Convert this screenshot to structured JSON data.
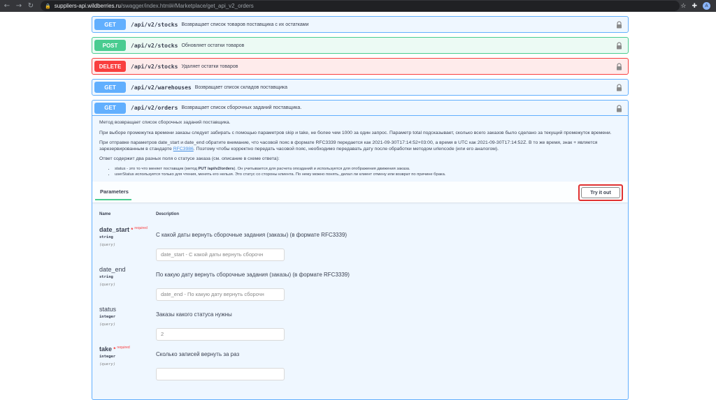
{
  "browser": {
    "url_host": "suppliers-api.wildberries.ru",
    "url_path": "/swagger/index.html#/Marketplace/get_api_v2_orders",
    "avatar_letter": "A"
  },
  "endpoints": [
    {
      "method": "GET",
      "path": "/api/v2/stocks",
      "summary": "Возвращает список товаров поставщика с их остатками",
      "kind": "get"
    },
    {
      "method": "POST",
      "path": "/api/v2/stocks",
      "summary": "Обновляет остатки товаров",
      "kind": "post"
    },
    {
      "method": "DELETE",
      "path": "/api/v2/stocks",
      "summary": "Удаляет остатки товаров",
      "kind": "delete"
    },
    {
      "method": "GET",
      "path": "/api/v2/warehouses",
      "summary": "Возвращает список складов поставщика",
      "kind": "get"
    }
  ],
  "expanded": {
    "method": "GET",
    "path": "/api/v2/orders",
    "summary": "Возвращает список сборочных заданий поставщика.",
    "desc1": "Метод возвращает список сборочных заданий поставщика.",
    "desc2": "При выборе промежутка времени заказы следует забирать с помощью параметров skip и take, не более чем 1000 за один запрос. Параметр total подсказывает, сколько всего заказов было сделано за текущий промежуток времени.",
    "desc3a": "При отправке параметров date_start и date_end обратите внимание, что часовой пояс в формате RFC3339 передается как 2021-09-30T17:14:52+03:00, а время в UTC как 2021-09-30T17:14:52Z. В то же время, знак + является зарезервированным в стандарте ",
    "desc3link": "RFC3986",
    "desc3b": ". Поэтому чтобы корректно передать часовой пояс, необходимо передавать дату после обработки методом urlencode (или его аналогом).",
    "desc4": "Ответ содержит два разных поля о статусе заказа (см. описание в схеме ответа):",
    "bullet1a": "status - это то что меняет поставщик (метод ",
    "bullet1b": "PUT /api/v2/orders",
    "bullet1c": "). Он учитывается для расчета опозданий и используется для отображения движения заказа.",
    "bullet2": "userStatus используется только для чтения, менять его нельзя. Это статус со стороны клиента. По нему можно понять, делал ли клиент отмену или возврат по причине брака."
  },
  "params": {
    "tab_label": "Parameters",
    "try_label": "Try it out",
    "col_name": "Name",
    "col_desc": "Description",
    "required_label": "required",
    "items": [
      {
        "name": "date_start",
        "required": true,
        "type": "string",
        "in": "(query)",
        "desc": "С какой даты вернуть сборочные задания (заказы) (в формате RFC3339)",
        "placeholder": "date_start - С какой даты вернуть сборочн"
      },
      {
        "name": "date_end",
        "required": false,
        "type": "string",
        "in": "(query)",
        "desc": "По какую дату вернуть сборочные задания (заказы) (в формате RFC3339)",
        "placeholder": "date_end - По какую дату вернуть сборочн"
      },
      {
        "name": "status",
        "required": false,
        "type": "integer",
        "in": "(query)",
        "desc": "Заказы какого статуса нужны",
        "placeholder": "2"
      },
      {
        "name": "take",
        "required": true,
        "type": "integer",
        "in": "(query)",
        "desc": "Сколько записей вернуть за раз",
        "placeholder": ""
      }
    ]
  }
}
